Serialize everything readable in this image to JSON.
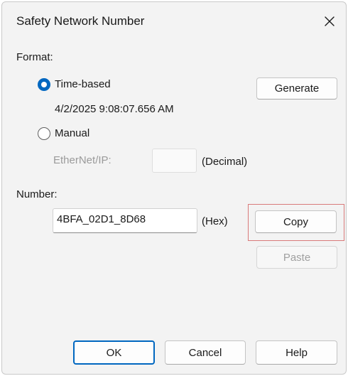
{
  "window": {
    "title": "Safety Network Number"
  },
  "format": {
    "label": "Format:",
    "time_based": {
      "label": "Time-based",
      "checked": true,
      "timestamp": "4/2/2025 9:08:07.656 AM"
    },
    "manual": {
      "label": "Manual",
      "checked": false
    },
    "ethernet_label": "EtherNet/IP:",
    "ethernet_value": "",
    "decimal_label": "(Decimal)"
  },
  "buttons": {
    "generate": "Generate",
    "copy": "Copy",
    "paste": "Paste",
    "ok": "OK",
    "cancel": "Cancel",
    "help": "Help"
  },
  "number": {
    "label": "Number:",
    "value": "4BFA_02D1_8D68",
    "hex_label": "(Hex)"
  },
  "colors": {
    "accent": "#0067c0",
    "highlight": "#d97a7a",
    "disabled_text": "#9a9a9a"
  }
}
